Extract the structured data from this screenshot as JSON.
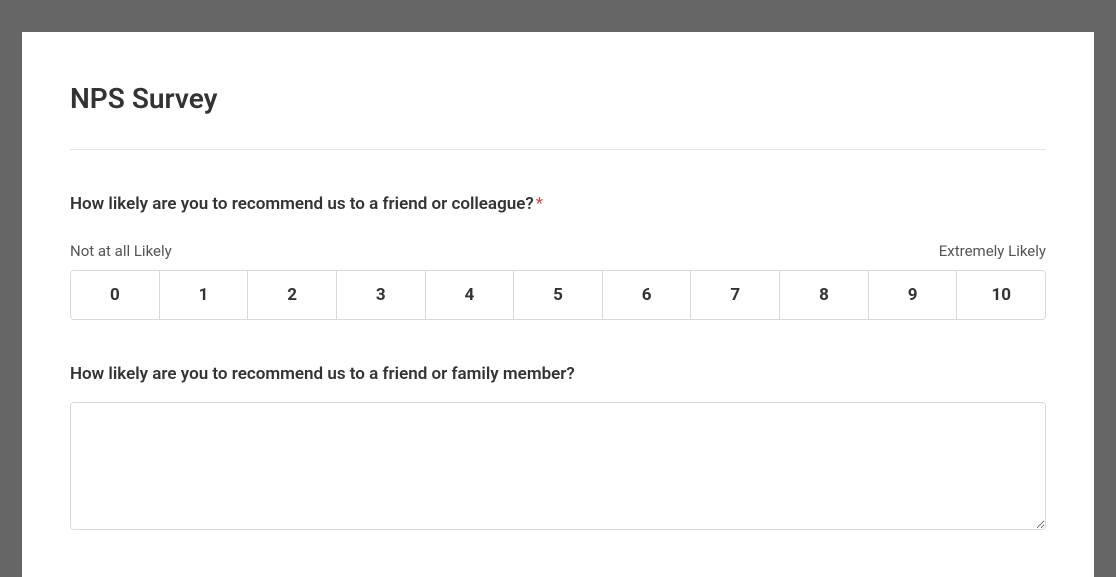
{
  "title": "NPS Survey",
  "q1": {
    "text": "How likely are you to recommend us to a friend or colleague?",
    "required_mark": "*",
    "low_label": "Not at all Likely",
    "high_label": "Extremely Likely",
    "options": [
      "0",
      "1",
      "2",
      "3",
      "4",
      "5",
      "6",
      "7",
      "8",
      "9",
      "10"
    ]
  },
  "q2": {
    "text": "How likely are you to recommend us to a friend or family member?",
    "value": ""
  }
}
